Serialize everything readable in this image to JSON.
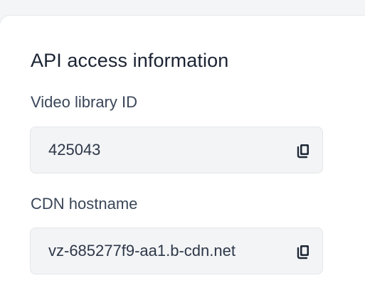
{
  "section": {
    "title": "API access information"
  },
  "fields": [
    {
      "label": "Video library ID",
      "value": "425043",
      "action_icon": "copy-icon"
    },
    {
      "label": "CDN hostname",
      "value": "vz-685277f9-aa1.b-cdn.net",
      "action_icon": "copy-icon"
    }
  ],
  "colors": {
    "background": "#f4f5f7",
    "card": "#ffffff",
    "field_bg": "#f3f4f6",
    "text_dark": "#1b2333",
    "text_label": "#3a4658"
  }
}
